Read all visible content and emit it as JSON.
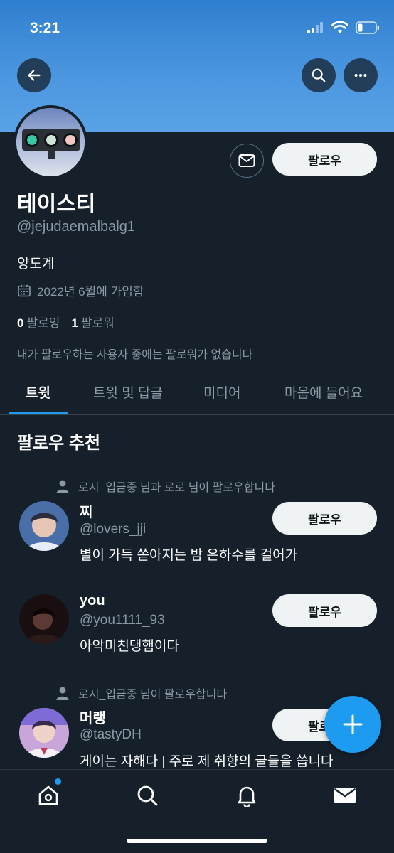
{
  "status_bar": {
    "time": "3:21"
  },
  "header": {
    "back_icon": "arrow-left-icon",
    "search_icon": "search-icon",
    "more_icon": "more-horizontal-icon"
  },
  "profile": {
    "name": "테이스티",
    "handle": "@jejudaemalbalg1",
    "bio": "양도계",
    "joined": "2022년 6월에 가입함",
    "following_count": "0",
    "following_label": "팔로잉",
    "followers_count": "1",
    "followers_label": "팔로워",
    "no_mutual": "내가 팔로우하는 사용자 중에는 팔로워가 없습니다",
    "follow_label": "팔로우"
  },
  "tabs": [
    {
      "label": "트윗"
    },
    {
      "label": "트윗 및 답글"
    },
    {
      "label": "미디어"
    },
    {
      "label": "마음에 들어요"
    }
  ],
  "suggestions": {
    "title": "팔로우 추천",
    "items": [
      {
        "social_context": "로시_입금중 님과 로로 님이 팔로우합니다",
        "name": "찌",
        "handle": "@lovers_jji",
        "bio": "별이 가득 쏟아지는 밤 은하수를 걸어가",
        "follow_label": "팔로우"
      },
      {
        "social_context": "",
        "name": "you",
        "handle": "@you1111_93",
        "bio": "아악미친댕햄이다",
        "follow_label": "팔로우"
      },
      {
        "social_context": "로시_입금중 님이 팔로우합니다",
        "name": "머랭",
        "handle": "@tastyDH",
        "bio": "게이는 자해다 | 주로 제 취향의 글들을 씁니다",
        "follow_label": "팔로우"
      }
    ]
  },
  "fab": {
    "icon": "plus-icon"
  },
  "bottom_nav": [
    "home-icon",
    "search-icon",
    "bell-icon",
    "mail-icon"
  ],
  "colors": {
    "background": "#15202b",
    "accent": "#1d9bf0",
    "secondary_text": "#8b98a5",
    "banner": "#4c97e0"
  }
}
